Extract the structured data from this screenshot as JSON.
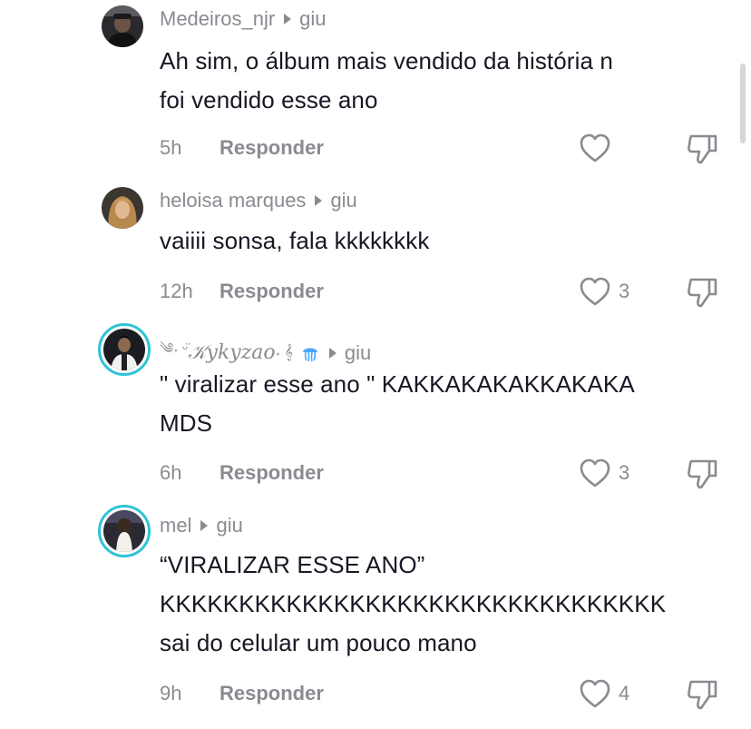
{
  "colors": {
    "text": "#161823",
    "muted": "#8a8b91",
    "story_ring": "#2fc4d6"
  },
  "comments": [
    {
      "username": "Medeiros_njr",
      "reply_to": "giu",
      "lines": [
        "Ah sim, o álbum mais vendido da história n",
        "foi vendido esse ano"
      ],
      "time": "5h",
      "reply_label": "Responder",
      "likes": ""
    },
    {
      "username": "heloisa marques",
      "reply_to": "giu",
      "lines": [
        "vaiiii sonsa, fala kkkkkkkk"
      ],
      "time": "12h",
      "reply_label": "Responder",
      "likes": "3"
    },
    {
      "username_prefix": "༄˖ ᵕ̈ ",
      "username": "𝒦ykyzao",
      "username_suffix": "˖ 𝄞",
      "reply_to": "giu",
      "lines": [
        "\" viralizar esse ano \" KAKKAKAKAKKAKAKA",
        "MDS"
      ],
      "time": "6h",
      "reply_label": "Responder",
      "likes": "3"
    },
    {
      "username": "mel",
      "reply_to": "giu",
      "lines": [
        "“VIRALIZAR ESSE ANO”",
        "KKKKKKKKKKKKKKKKKKKKKKKKKKKKKKKK",
        "sai do celular um pouco mano"
      ],
      "time": "9h",
      "reply_label": "Responder",
      "likes": "4"
    }
  ]
}
